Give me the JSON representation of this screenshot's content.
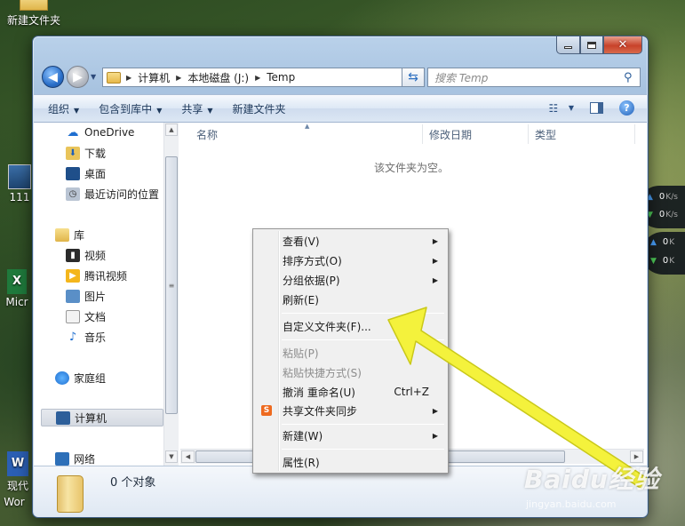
{
  "desktop": {
    "icons": [
      {
        "label": "新建文件夹"
      },
      {
        "label": "111"
      },
      {
        "label": "Micr"
      },
      {
        "label": "现代"
      },
      {
        "label": "Wor"
      }
    ]
  },
  "window": {
    "address": {
      "crumbs": [
        "计算机",
        "本地磁盘 (J:)",
        "Temp"
      ]
    },
    "search": {
      "placeholder": "搜索 Temp"
    },
    "toolbar": {
      "organize": "组织",
      "include_in_library": "包含到库中",
      "share": "共享",
      "new_folder": "新建文件夹"
    },
    "nav": {
      "favorites": [
        {
          "label": "OneDrive"
        },
        {
          "label": "下载"
        },
        {
          "label": "桌面"
        },
        {
          "label": "最近访问的位置"
        }
      ],
      "libraries_label": "库",
      "libraries": [
        {
          "label": "视频"
        },
        {
          "label": "腾讯视频"
        },
        {
          "label": "图片"
        },
        {
          "label": "文档"
        },
        {
          "label": "音乐"
        }
      ],
      "homegroup": "家庭组",
      "computer": "计算机",
      "network": "网络"
    },
    "columns": [
      "名称",
      "修改日期",
      "类型"
    ],
    "empty_message": "该文件夹为空。",
    "details": {
      "count": "0 个对象"
    }
  },
  "context_menu": {
    "items": [
      {
        "label": "查看(V)",
        "submenu": true
      },
      {
        "label": "排序方式(O)",
        "submenu": true
      },
      {
        "label": "分组依据(P)",
        "submenu": true
      },
      {
        "label": "刷新(E)"
      },
      {
        "label": "自定义文件夹(F)..."
      },
      {
        "label": "粘贴(P)",
        "disabled": true
      },
      {
        "label": "粘贴快捷方式(S)",
        "disabled": true
      },
      {
        "label": "撤消 重命名(U)",
        "accelerator": "Ctrl+Z"
      },
      {
        "label": "共享文件夹同步",
        "submenu": true,
        "icon": "S"
      },
      {
        "label": "新建(W)",
        "submenu": true
      },
      {
        "label": "属性(R)"
      }
    ]
  },
  "speed_widgets": [
    {
      "up": "0",
      "up_unit": "K/s",
      "down": "0",
      "down_unit": "K/s"
    },
    {
      "up": "0",
      "up_unit": "K",
      "down": "0",
      "down_unit": "K"
    }
  ],
  "watermark": {
    "brand": "Baidu经验",
    "url": "jingyan.baidu.com"
  },
  "colors": {
    "arrow": "#f2f23a",
    "accent": "#2a6fc9"
  }
}
